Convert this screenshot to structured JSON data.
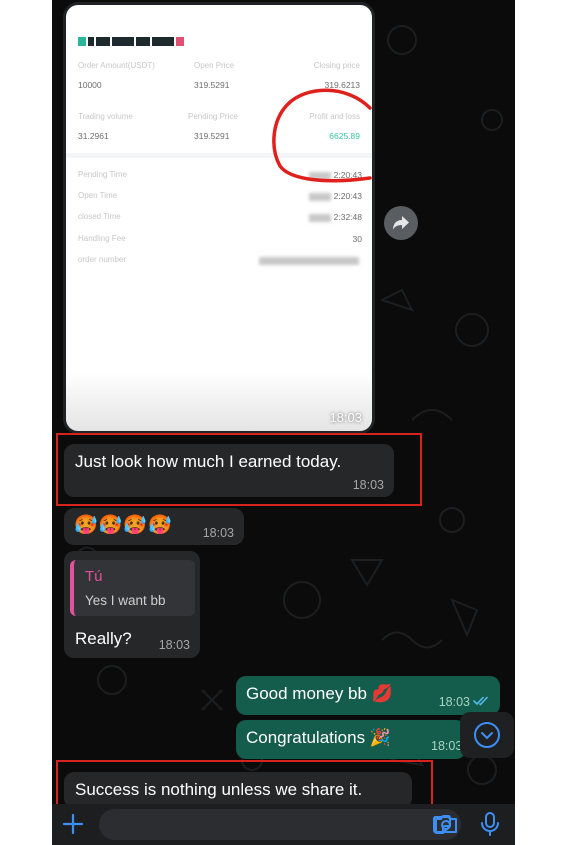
{
  "order_card": {
    "labels": {
      "order_amount": "Order Amount(USDT)",
      "open_price": "Open Price",
      "closing_price": "Closing price",
      "trading_volume": "Trading volume",
      "pending_price": "Pending Price",
      "profit_loss": "Profit and loss",
      "pending_time": "Pending Time",
      "open_time": "Open Time",
      "closed_time": "closed Time",
      "handling_fee": "Handling Fee",
      "order_number": "order number"
    },
    "values": {
      "order_amount": "10000",
      "open_price": "319.5291",
      "closing_price": "319.6213",
      "trading_volume": "31.2961",
      "pending_price": "319.5291",
      "profit_loss": "6625.89",
      "pending_time": "2:20:43",
      "open_time": "2:20:43",
      "closed_time": "2:32:48",
      "handling_fee": "30"
    },
    "time": "18:03"
  },
  "messages": [
    {
      "id": "earned",
      "text": "Just look how much I earned today.",
      "time": "18:03"
    },
    {
      "id": "emoji",
      "text": "🥵🥵🥵🥵",
      "time": "18:03"
    },
    {
      "id": "really",
      "reply_author": "Tú",
      "reply_text": "Yes I want bb",
      "text": "Really?",
      "time": "18:03"
    },
    {
      "id": "good-money",
      "text": "Good money bb 💋",
      "time": "18:03",
      "status": "read"
    },
    {
      "id": "congrats",
      "text": "Congratulations 🎉",
      "time": "18:03"
    },
    {
      "id": "success",
      "text": "Success is nothing unless we share it."
    }
  ],
  "icons": [
    "forward-icon",
    "chevron-down-icon",
    "plus-icon",
    "sticker-icon",
    "camera-icon",
    "microphone-icon",
    "read-receipt-icon"
  ],
  "colors": {
    "chat_bg": "#0b0b0b",
    "incoming_bubble": "#262729",
    "outgoing_bubble": "#145c4c",
    "highlight_red": "#d6231f",
    "accent_blue": "#3d8ff5",
    "profit_green": "#3ac4a2"
  }
}
